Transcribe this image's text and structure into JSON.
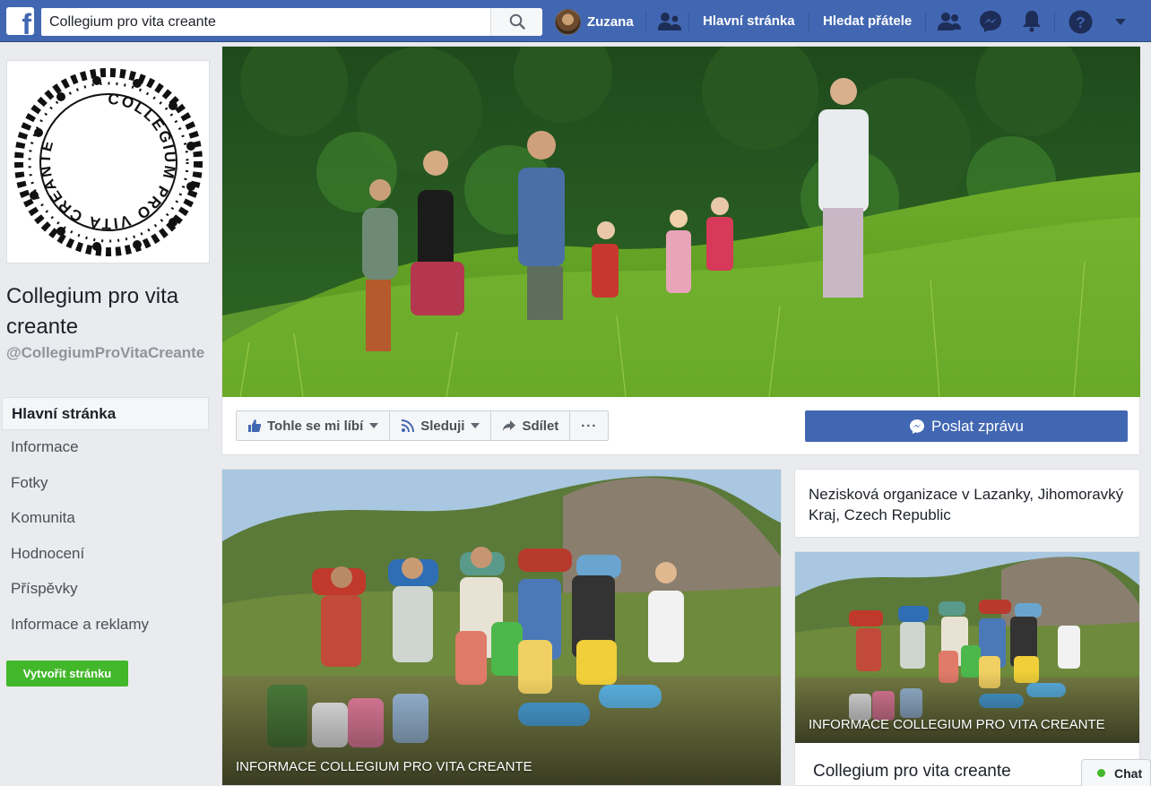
{
  "header": {
    "logo_letter": "f",
    "search_value": "Collegium pro vita creante",
    "user_name": "Zuzana",
    "home_link": "Hlavní stránka",
    "find_friends_link": "Hledat přátele"
  },
  "sidebar": {
    "page_name": "Collegium pro vita creante",
    "page_handle": "@CollegiumProVitaCreante",
    "items": [
      {
        "label": "Hlavní stránka",
        "active": true
      },
      {
        "label": "Informace"
      },
      {
        "label": "Fotky"
      },
      {
        "label": "Komunita"
      },
      {
        "label": "Hodnocení"
      },
      {
        "label": "Příspěvky"
      },
      {
        "label": "Informace a reklamy"
      }
    ],
    "create_page_label": "Vytvořit stránku"
  },
  "logo_text": "COLLEGIUM PRO VITA CREANTE",
  "actions": {
    "like_label": "Tohle se mi líbí",
    "follow_label": "Sleduji",
    "share_label": "Sdílet",
    "more_label": "···",
    "send_message_label": "Poslat zprávu"
  },
  "main_photo": {
    "caption": "INFORMACE COLLEGIUM PRO VITA CREANTE"
  },
  "about": {
    "text": "Nezisková organizace v Lazanky, Jihomoravký Kraj, Czech Republic"
  },
  "side_photo": {
    "caption": "INFORMACE COLLEGIUM PRO VITA CREANTE",
    "title": "Collegium pro vita creante"
  },
  "chat": {
    "label": "Chat"
  },
  "colors": {
    "brand": "#4267b2",
    "create_button": "#42b72a",
    "background": "#e9ebee"
  }
}
